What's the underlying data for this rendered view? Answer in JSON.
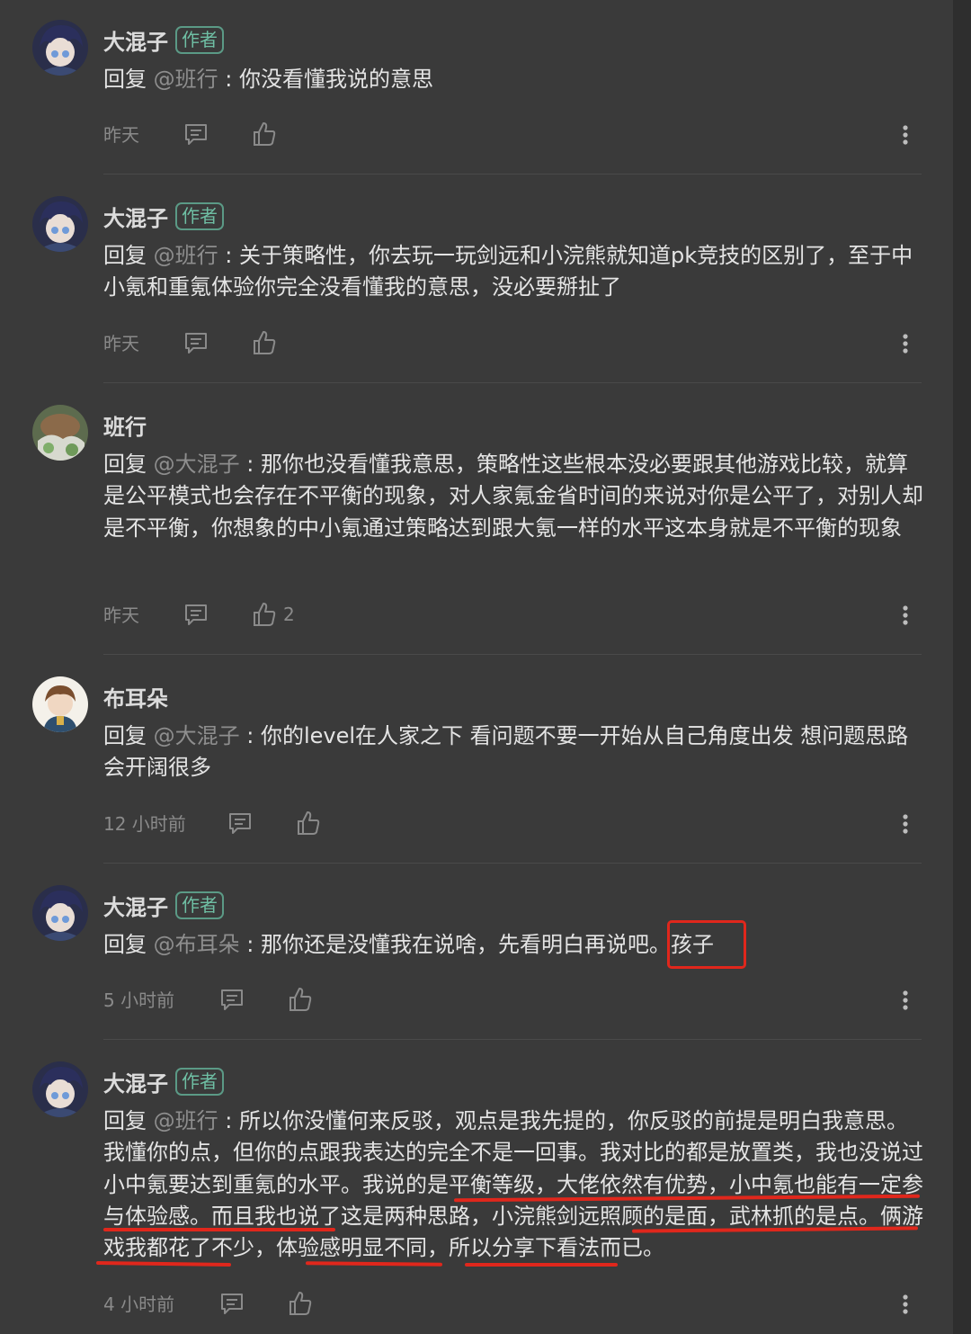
{
  "comments": [
    {
      "name": "大混子",
      "badge": "作者",
      "reply_prefix": "回复 ",
      "reply_to": "@班行",
      "sep": " : ",
      "text": "你没看懂我说的意思",
      "time": "昨天",
      "likes": "",
      "avatar": "anime-dark-hair-avatar"
    },
    {
      "name": "大混子",
      "badge": "作者",
      "reply_prefix": "回复 ",
      "reply_to": "@班行",
      "sep": " : ",
      "text": "关于策略性，你去玩一玩剑远和小浣熊就知道pk竞技的区别了，至于中小氪和重氪体验你完全没看懂我的意思，没必要掰扯了",
      "time": "昨天",
      "likes": "",
      "avatar": "anime-dark-hair-avatar"
    },
    {
      "name": "班行",
      "badge": "",
      "reply_prefix": "回复 ",
      "reply_to": "@大混子",
      "sep": " : ",
      "text": "那你也没看懂我意思，策略性这些根本没必要跟其他游戏比较，就算是公平模式也会存在不平衡的现象，对人家氪金省时间的来说对你是公平了，对别人却是不平衡，你想象的中小氪通过策略达到跟大氪一样的水平这本身就是不平衡的现象",
      "time": "昨天",
      "likes": "2",
      "avatar": "green-brown-avatar"
    },
    {
      "name": "布耳朵",
      "badge": "",
      "reply_prefix": "回复 ",
      "reply_to": "@大混子",
      "sep": " : ",
      "text": "你的level在人家之下 看问题不要一开始从自己角度出发 想问题思路会开阔很多",
      "time": "12 小时前",
      "likes": "",
      "avatar": "anime-brown-hair-avatar"
    },
    {
      "name": "大混子",
      "badge": "作者",
      "reply_prefix": "回复 ",
      "reply_to": "@布耳朵",
      "sep": " : ",
      "text": "那你还是没懂我在说啥，先看明白再说吧。孩子",
      "time": "5 小时前",
      "likes": "",
      "avatar": "anime-dark-hair-avatar"
    },
    {
      "name": "大混子",
      "badge": "作者",
      "reply_prefix": "回复 ",
      "reply_to": "@班行",
      "sep": " : ",
      "text": "所以你没懂何来反驳，观点是我先提的，你反驳的前提是明白我意思。我懂你的点，但你的点跟我表达的完全不是一回事。我对比的都是放置类，我也没说过小中氪要达到重氪的水平。我说的是平衡等级，大佬依然有优势，小中氪也能有一定参与体验感。而且我也说了这是两种思路，小浣熊剑远照顾的是面，武林抓的是点。俩游戏我都花了不少，体验感明显不同，所以分享下看法而已。",
      "time": "4 小时前",
      "likes": "",
      "avatar": "anime-dark-hair-avatar"
    }
  ],
  "colors": {
    "background": "#3a3a3a",
    "badge": "#6fbfa4",
    "annotation_red": "#e0271c",
    "muted": "#8a8a8a"
  },
  "icons": {
    "comment": "comment-bubble-icon",
    "like": "thumbs-up-icon",
    "more": "more-vertical-icon"
  }
}
